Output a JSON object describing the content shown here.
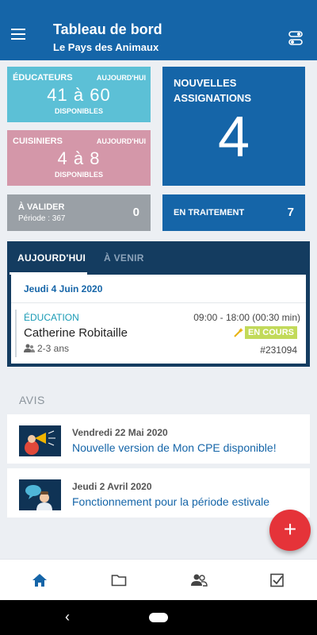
{
  "header": {
    "title": "Tableau de bord",
    "subtitle": "Le Pays des Animaux"
  },
  "tiles": {
    "educators": {
      "label": "ÉDUCATEURS",
      "period": "AUJOURD'HUI",
      "value": "41 à 60",
      "caption": "DISPONIBLES"
    },
    "cooks": {
      "label": "CUISINIERS",
      "period": "AUJOURD'HUI",
      "value": "4 à 8",
      "caption": "DISPONIBLES"
    },
    "new_assignments": {
      "label": "NOUVELLES ASSIGNATIONS",
      "value": "4"
    },
    "to_validate": {
      "label": "À VALIDER",
      "period": "Période : 367",
      "count": "0"
    },
    "processing": {
      "label": "EN TRAITEMENT",
      "count": "7"
    }
  },
  "schedule": {
    "tabs": [
      "AUJOURD'HUI",
      "À VENIR"
    ],
    "day": {
      "date": "Jeudi 4 Juin 2020",
      "shift": {
        "category": "ÉDUCATION",
        "time": "09:00 - 18:00 (00:30 min)",
        "name": "Catherine Robitaille",
        "status": "EN COURS",
        "group": "2-3 ans",
        "id": "#231094"
      }
    }
  },
  "notices": {
    "title": "AVIS",
    "items": [
      {
        "date": "Vendredi 22 Mai 2020",
        "title": "Nouvelle version de Mon CPE disponible!"
      },
      {
        "date": "Jeudi 2 Avril 2020",
        "title": "Fonctionnement pour la période estivale"
      }
    ]
  },
  "fab": {
    "label": "+"
  },
  "bottom_nav": [
    "home-icon",
    "folder-icon",
    "people-icon",
    "checkbox-icon"
  ],
  "colors": {
    "primary": "#1565a8",
    "educators": "#5cc0d6",
    "cooks": "#d497a9",
    "validate": "#9aa0a6",
    "schedule_bg": "#143c60",
    "status_badge": "#c2da5a",
    "fab": "#e53339"
  }
}
